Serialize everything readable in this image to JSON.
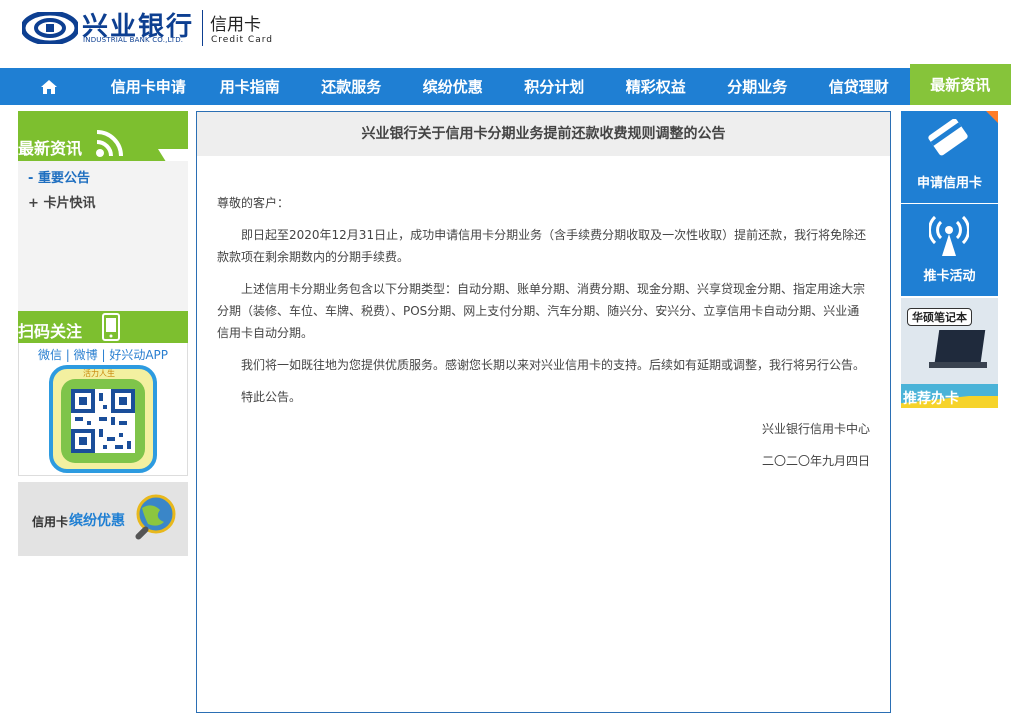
{
  "header": {
    "logo_cn": "兴业银行",
    "logo_en": "INDUSTRIAL BANK CO.,LTD.",
    "card_cn": "信用卡",
    "card_en": "Credit  Card"
  },
  "nav": {
    "items": [
      {
        "label": "信用卡申请"
      },
      {
        "label": "用卡指南"
      },
      {
        "label": "还款服务"
      },
      {
        "label": "缤纷优惠"
      },
      {
        "label": "积分计划"
      },
      {
        "label": "精彩权益"
      },
      {
        "label": "分期业务"
      },
      {
        "label": "信贷理财"
      },
      {
        "label": "最新资讯"
      }
    ],
    "active_index": 8,
    "colors": {
      "bar": "#1f7fd3",
      "active": "#86c43a"
    }
  },
  "sidebar": {
    "news_title": "最新资讯",
    "links": [
      {
        "prefix": "-",
        "label": "重要公告"
      },
      {
        "prefix": "+",
        "label": "卡片快讯"
      }
    ],
    "scan_title": "扫码关注",
    "scan_text": "微信 | 微博 | 好兴动APP",
    "qr_badge": "活力人生",
    "promo_prefix": "信用卡",
    "promo_highlight": "缤纷优惠"
  },
  "article": {
    "title": "兴业银行关于信用卡分期业务提前还款收费规则调整的公告",
    "greeting": "尊敬的客户：",
    "paragraphs": [
      "即日起至2020年12月31日止，成功申请信用卡分期业务（含手续费分期收取及一次性收取）提前还款，我行将免除还款款项在剩余期数内的分期手续费。",
      "上述信用卡分期业务包含以下分期类型：自动分期、账单分期、消费分期、现金分期、兴享贷现金分期、指定用途大宗分期（装修、车位、车牌、税费）、POS分期、网上支付分期、汽车分期、随兴分、安兴分、立享信用卡自动分期、兴业通信用卡自动分期。",
      "我们将一如既往地为您提供优质服务。感谢您长期以来对兴业信用卡的支持。后续如有延期或调整，我行将另行公告。",
      "特此公告。"
    ],
    "signature": "兴业银行信用卡中心",
    "date": "二〇二〇年九月四日"
  },
  "right_rail": {
    "apply_label": "申请信用卡",
    "promote_label": "推卡活动",
    "ad_label": "华硕笔记本",
    "ad_bottom_text": "推荐办卡"
  }
}
